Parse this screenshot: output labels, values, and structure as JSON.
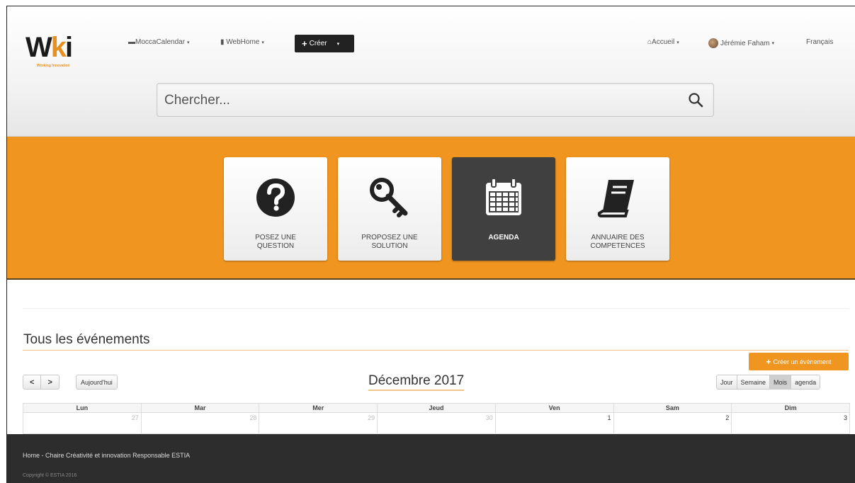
{
  "header": {
    "logo_text_left": "W",
    "logo_text_mid": "k",
    "logo_text_right": "i",
    "logo_subtitle": "Working Innovation",
    "nav_calendar": "MoccaCalendar",
    "nav_webhome": "WebHome",
    "create_label": "Créer",
    "nav_accueil": "Accueil",
    "nav_user": "Jérémie Faham",
    "nav_language": "Français"
  },
  "search": {
    "placeholder": "Chercher..."
  },
  "tiles": [
    {
      "label_line1": "POSEZ UNE",
      "label_line2": "QUESTION",
      "icon": "question-icon"
    },
    {
      "label_line1": "PROPOSEZ UNE",
      "label_line2": "SOLUTION",
      "icon": "key-icon"
    },
    {
      "label_line1": "AGENDA",
      "label_line2": "",
      "icon": "calendar-icon",
      "active": true
    },
    {
      "label_line1": "ANNUAIRE DES",
      "label_line2": "COMPETENCES",
      "icon": "book-icon"
    }
  ],
  "events": {
    "section_title": "Tous les événements",
    "create_event_label": "Créer un événement",
    "prev_label": "<",
    "next_label": ">",
    "today_label": "Aujourd'hui",
    "month_title": "Décembre 2017",
    "views": [
      "Jour",
      "Semaine",
      "Mois",
      "agenda"
    ],
    "active_view": "Mois",
    "weekdays": [
      "Lun",
      "Mar",
      "Mer",
      "Jeud",
      "Ven",
      "Sam",
      "Dim"
    ],
    "first_week": [
      "27",
      "28",
      "29",
      "30",
      "1",
      "2",
      "3"
    ]
  },
  "footer": {
    "links": "Home  -  Chaire Créativité et innovation Responsable ESTIA",
    "copyright": "Copyright © ESTIA 2016"
  },
  "colors": {
    "accent": "#f0951f",
    "dark": "#404040",
    "footer": "#2d2d2d"
  }
}
